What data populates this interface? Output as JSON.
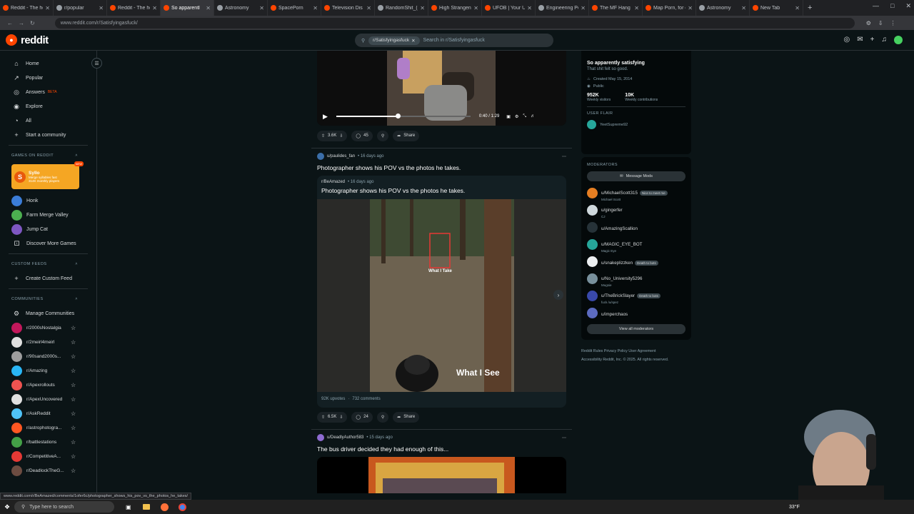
{
  "browser": {
    "tabs": [
      {
        "label": "Reddit - The hea"
      },
      {
        "label": "r/popular"
      },
      {
        "label": "Reddit - The hea"
      },
      {
        "label": "So apparentl",
        "active": true
      },
      {
        "label": "Astronomy"
      },
      {
        "label": "SpacePorn"
      },
      {
        "label": "Television Dis"
      },
      {
        "label": "RandomShit_(Saw"
      },
      {
        "label": "High Strangeness"
      },
      {
        "label": "UFOB | Your UAP"
      },
      {
        "label": "Engineering Porn"
      },
      {
        "label": "The MF Hang Out"
      },
      {
        "label": "Map Porn, for en"
      },
      {
        "label": "Astronomy"
      },
      {
        "label": "New Tab"
      }
    ],
    "new_tab_symbol": "+",
    "url": "www.reddit.com/r/Satisfyingasfuck/",
    "status_url": "www.reddit.com/r/BeAmazed/comments/1ofer6c/photographer_shows_his_pov_vs_the_photos_he_takes/"
  },
  "header": {
    "logo_text": "reddit",
    "search_chip": "r/Satisfyingasfuck",
    "search_placeholder": "Search in r/Satisfyingasfuck"
  },
  "sidebar": {
    "nav": [
      {
        "label": "Home",
        "icon": "home-icon"
      },
      {
        "label": "Popular",
        "icon": "popular-icon"
      },
      {
        "label": "Answers",
        "icon": "answers-icon",
        "badge": "BETA"
      },
      {
        "label": "Explore",
        "icon": "explore-icon"
      },
      {
        "label": "All",
        "icon": "all-icon"
      },
      {
        "label": "Start a community",
        "icon": "plus-icon"
      }
    ],
    "games_header": "GAMES ON REDDIT",
    "syllo": {
      "title": "Syllo",
      "subtitle": "Merge syllables fast",
      "players": "314K monthly players",
      "badge": "NEW"
    },
    "games": [
      {
        "label": "Honk",
        "color": "#3b7dd8"
      },
      {
        "label": "Farm Merge Valley",
        "color": "#4caf50"
      },
      {
        "label": "Jump Cat",
        "color": "#7e57c2"
      },
      {
        "label": "Discover More Games",
        "color": ""
      }
    ],
    "custom_feeds_header": "CUSTOM FEEDS",
    "create_feed": "Create Custom Feed",
    "communities_header": "COMMUNITIES",
    "manage": "Manage Communities",
    "communities": [
      {
        "name": "r/2000sNostalgia",
        "color": "#c2185b"
      },
      {
        "name": "r/2meirl4meirl",
        "color": "#e0e0e0"
      },
      {
        "name": "r/90sand2000s...",
        "color": "#9e9e9e"
      },
      {
        "name": "r/Amazing",
        "color": "#29b6f6"
      },
      {
        "name": "r/Apexrollouts",
        "color": "#ef5350"
      },
      {
        "name": "r/ApexUncovered",
        "color": "#e0e0e0"
      },
      {
        "name": "r/AskReddit",
        "color": "#4fc3f7"
      },
      {
        "name": "r/astrophotogra...",
        "color": "#ff5722"
      },
      {
        "name": "r/battlestations",
        "color": "#43a047"
      },
      {
        "name": "r/CompetitiveA...",
        "color": "#e53935"
      },
      {
        "name": "r/DeadlockTheG...",
        "color": "#6d4c41"
      }
    ]
  },
  "feed": {
    "post1": {
      "time": "0:40 / 1:29",
      "votes": "3.6K",
      "comments": "45",
      "share": "Share"
    },
    "post2": {
      "author": "u/paulides_fan",
      "age": "• 16 days ago",
      "title": "Photographer shows his POV vs the photos he takes.",
      "crosspost_sub": "r/BeAmazed",
      "crosspost_age": "• 16 days ago",
      "crosspost_title": "Photographer shows his POV vs the photos he takes.",
      "overlay_take": "What I Take",
      "overlay_see": "What I See",
      "upvotes": "92K upvotes",
      "comments_count": "732 comments",
      "votes": "6.5K",
      "comments": "24",
      "share": "Share"
    },
    "post3": {
      "author": "u/DeadlyAuthor583",
      "age": "• 15 days ago",
      "title": "The bus driver decided they had enough of this..."
    }
  },
  "right": {
    "title": "So apparently satisfying",
    "desc": "That shit felt so good.",
    "created": "Created May 15, 2014",
    "visibility": "Public",
    "visitors": "952K",
    "visitors_label": "Weekly visitors",
    "contribs": "10K",
    "contribs_label": "Weekly contributions",
    "user_flair_head": "USER FLAIR",
    "user_flair": "YeetSupreme92",
    "mods_head": "MODERATORS",
    "message_mods": "Message Mods",
    "mods": [
      {
        "name": "u/MichaelScott315",
        "flair": "Nice to meet me",
        "sub": "Michael Scott",
        "color": "#e67e22"
      },
      {
        "name": "u/gingerfer",
        "flair": "",
        "sub": "CJ",
        "color": "#cfd8dc"
      },
      {
        "name": "u/AmazingScallion",
        "flair": "",
        "sub": "",
        "color": "#263238"
      },
      {
        "name": "u/MAGIC_EYE_BOT",
        "flair": "",
        "sub": "Magic Eye",
        "color": "#26a69a"
      },
      {
        "name": "u/snakeplizzken",
        "flair": "Death to bots",
        "sub": "",
        "color": "#eceff1"
      },
      {
        "name": "u/No_University5296",
        "flair": "",
        "sub": "Mugsie",
        "color": "#78909c"
      },
      {
        "name": "u/TheBrickSlayer",
        "flair": "Death to bots",
        "sub": "fuck /u/spez",
        "color": "#3949ab"
      },
      {
        "name": "u/imperchaos",
        "flair": "",
        "sub": "",
        "color": "#5c6bc0"
      }
    ],
    "view_all": "View all moderators",
    "footer1": "Reddit Rules   Privacy Policy   User Agreement",
    "footer2": "Accessibility   Reddit, Inc. © 2025. All rights reserved."
  },
  "taskbar": {
    "search": "Type here to search",
    "weather": "33°F"
  }
}
